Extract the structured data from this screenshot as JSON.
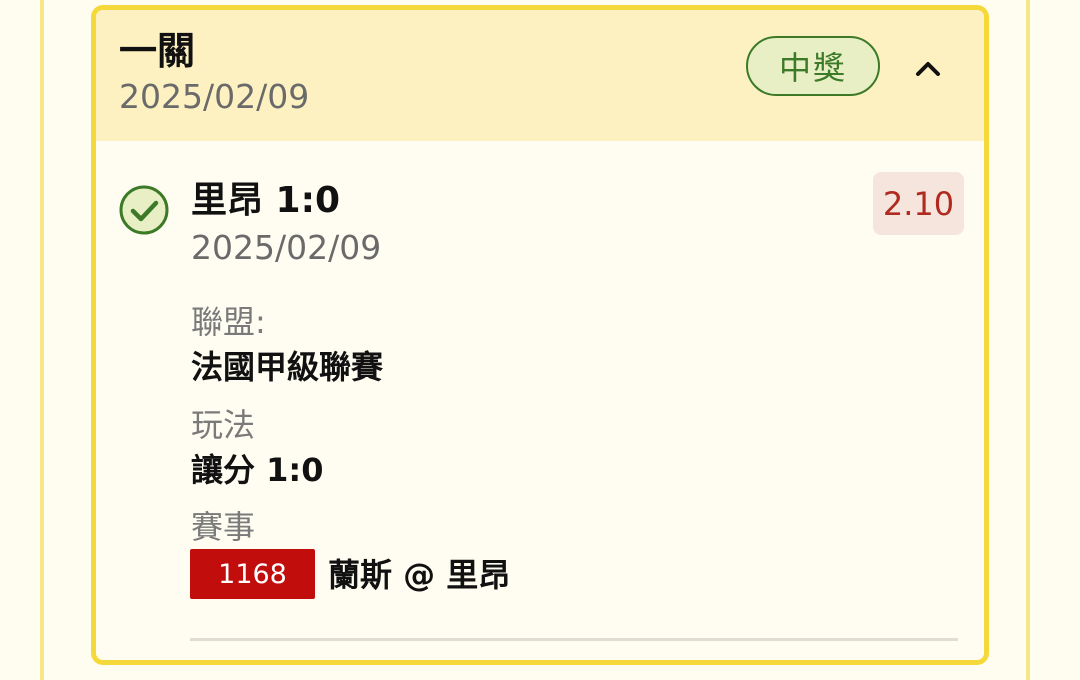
{
  "bet": {
    "type_label": "一關",
    "date": "2025/02/09",
    "status": "中獎",
    "colors": {
      "card_border": "#f5d93a",
      "header_bg": "#fdf1c2",
      "win_green": "#3c7a28",
      "odds_red": "#b02a1f",
      "match_red": "#c20d0d"
    }
  },
  "selection": {
    "title": "里昂 1:0",
    "date": "2025/02/09",
    "odds": "2.10",
    "fields": {
      "league_label": "聯盟:",
      "league_value": "法國甲級聯賽",
      "play_label": "玩法",
      "play_value": "讓分 1:0",
      "match_label": "賽事",
      "match_number": "1168",
      "match_teams": "蘭斯 @ 里昂"
    }
  },
  "icons": {
    "check": "check-circle-icon",
    "collapse": "chevron-up-icon"
  }
}
